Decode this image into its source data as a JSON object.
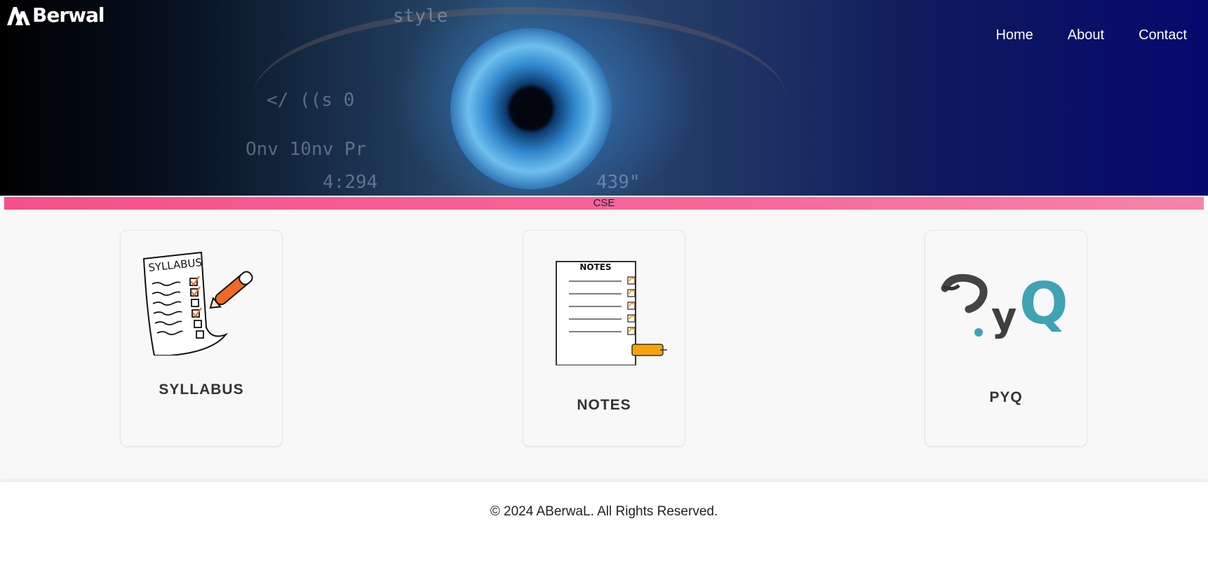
{
  "brand": {
    "name": "Berwal",
    "logo_icon": "ab-monogram-icon"
  },
  "nav": {
    "home": "Home",
    "about": "About",
    "contact": "Contact"
  },
  "banner": {
    "label": "CSE"
  },
  "cards": [
    {
      "label": "SYLLABUS",
      "sheet_title": "SYLLABUS",
      "icon": "syllabus-checklist-icon"
    },
    {
      "label": "NOTES",
      "sheet_title": "NOTES",
      "icon": "notes-page-icon"
    },
    {
      "label": "PYQ",
      "logo_text_p": "?y",
      "logo_text_q": "Q",
      "icon": "pyq-logo-icon"
    }
  ],
  "footer": {
    "copyright": "© 2024 ABerwaL. All Rights Reserved."
  },
  "colors": {
    "nav_text": "#ffffff",
    "banner_pink": "#f5508a",
    "card_text": "#333333",
    "pyq_teal": "#3fa3b3",
    "notes_orange": "#f5a20c",
    "pen_orange": "#f06a24"
  }
}
